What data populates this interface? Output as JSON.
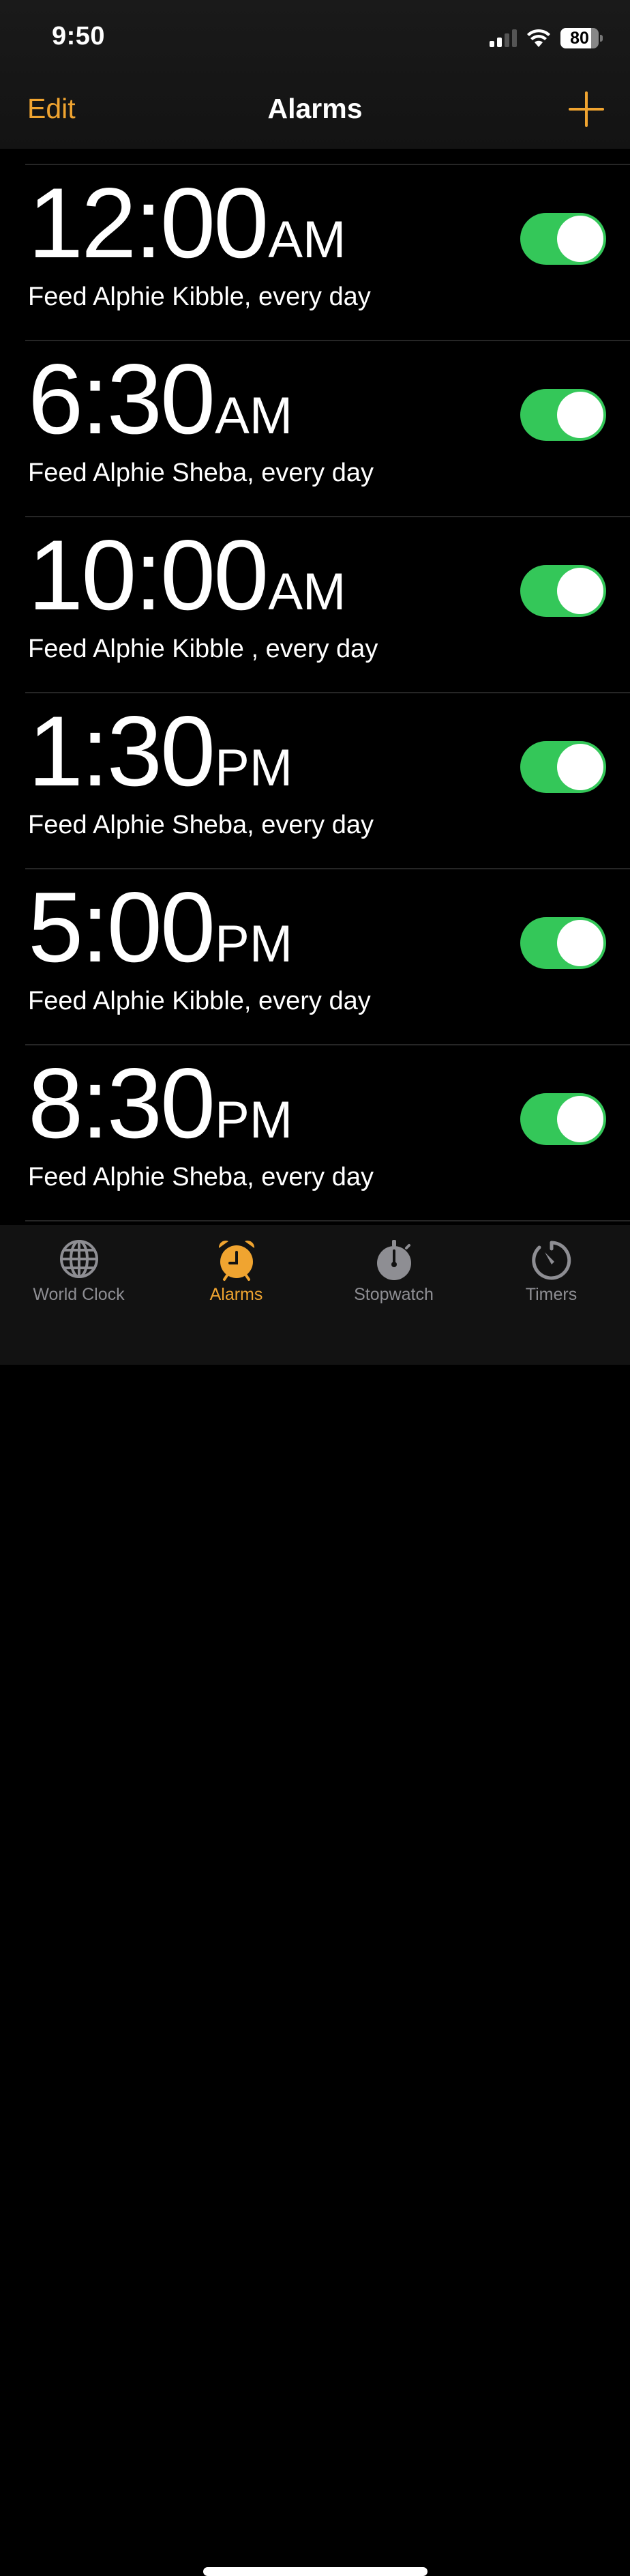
{
  "status_bar": {
    "time": "9:50",
    "signal_bars_active": 2,
    "signal_bars_total": 4,
    "battery_percent": "80"
  },
  "nav": {
    "edit_label": "Edit",
    "title": "Alarms",
    "add_icon": "plus-icon"
  },
  "colors": {
    "accent": "#F0A430",
    "toggle_on": "#34C759",
    "inactive_tab": "#8E8E93"
  },
  "alarms": [
    {
      "time": "12:00",
      "period": "AM",
      "label": "Feed Alphie Kibble, every day",
      "enabled": true
    },
    {
      "time": "6:30",
      "period": "AM",
      "label": "Feed Alphie Sheba, every day",
      "enabled": true
    },
    {
      "time": "10:00",
      "period": "AM",
      "label": "Feed Alphie Kibble , every day",
      "enabled": true
    },
    {
      "time": "1:30",
      "period": "PM",
      "label": "Feed Alphie Sheba, every day",
      "enabled": true
    },
    {
      "time": "5:00",
      "period": "PM",
      "label": "Feed Alphie Kibble, every day",
      "enabled": true
    },
    {
      "time": "8:30",
      "period": "PM",
      "label": "Feed Alphie Sheba, every day",
      "enabled": true
    }
  ],
  "tabs": [
    {
      "label": "World Clock",
      "icon": "globe-icon",
      "active": false
    },
    {
      "label": "Alarms",
      "icon": "alarm-clock-icon",
      "active": true
    },
    {
      "label": "Stopwatch",
      "icon": "stopwatch-icon",
      "active": false
    },
    {
      "label": "Timers",
      "icon": "timer-icon",
      "active": false
    }
  ]
}
